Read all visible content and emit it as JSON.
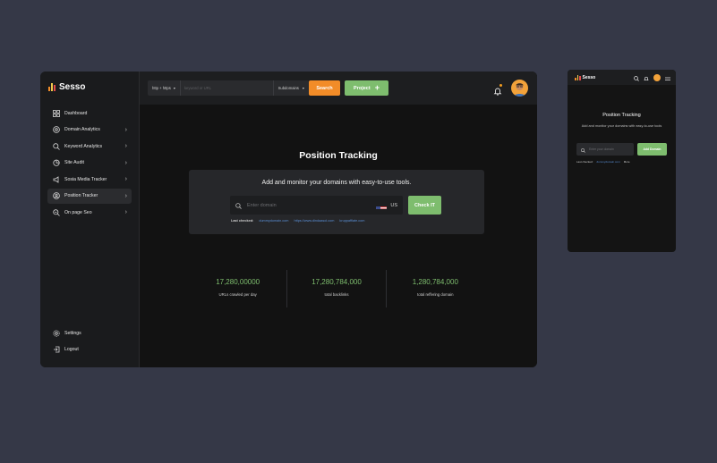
{
  "brand": {
    "name": "Sesso",
    "bar_colors": [
      "#f28c28",
      "#f2c94c",
      "#e24b4b"
    ]
  },
  "sidebar": {
    "items": [
      {
        "label": "Dashboard",
        "icon": "grid-icon",
        "has_chevron": false,
        "active": false
      },
      {
        "label": "Domain Analytics",
        "icon": "globe-icon",
        "has_chevron": true,
        "active": false
      },
      {
        "label": "Keyword Analytics",
        "icon": "search-chart-icon",
        "has_chevron": true,
        "active": false
      },
      {
        "label": "Site Audit",
        "icon": "pie-chart-icon",
        "has_chevron": true,
        "active": false
      },
      {
        "label": "Sosia Media Tracker",
        "icon": "megaphone-icon",
        "has_chevron": true,
        "active": false
      },
      {
        "label": "Position Tracker",
        "icon": "user-circle-icon",
        "has_chevron": true,
        "active": true
      },
      {
        "label": "On page Seo",
        "icon": "zoom-icon",
        "has_chevron": true,
        "active": false
      }
    ],
    "bottom": [
      {
        "label": "Settings",
        "icon": "gear-icon"
      },
      {
        "label": "Logout",
        "icon": "logout-icon"
      }
    ]
  },
  "topbar": {
    "protocol": "http + https",
    "keyword_placeholder": "keyword or URL",
    "subdomains": "Subdomains",
    "search_label": "Search",
    "project_label": "Project"
  },
  "main": {
    "title": "Position Tracking",
    "subtitle": "Add and monitor your domains with easy-to-use tools.",
    "domain_placeholder": "Enter domain",
    "country": "US",
    "check_label": "Check IT",
    "last_checked_label": "Last checked:",
    "last_checked_links": [
      "dummydomain.com",
      "https://www.dindaasol.com",
      "kruppafflate.com"
    ]
  },
  "stats": [
    {
      "value": "17,280,00000",
      "label": "URLs crawled per day"
    },
    {
      "value": "17,280,784,000",
      "label": "total backlinks"
    },
    {
      "value": "1,280,784,000",
      "label": "total reffering domain"
    }
  ],
  "mobile": {
    "title": "Position Tracking",
    "subtitle": "Add and monitor your domains with easy-to-use tools",
    "domain_placeholder": "Enter your domain",
    "button_label": "Add Domain",
    "last_checked_label": "Last checked:",
    "last_checked_link": "dummydomain.com",
    "more_label": "More"
  },
  "colors": {
    "accent_green": "#7ebd6e",
    "accent_orange": "#f28c28",
    "background": "#353847",
    "panel": "#141414"
  }
}
